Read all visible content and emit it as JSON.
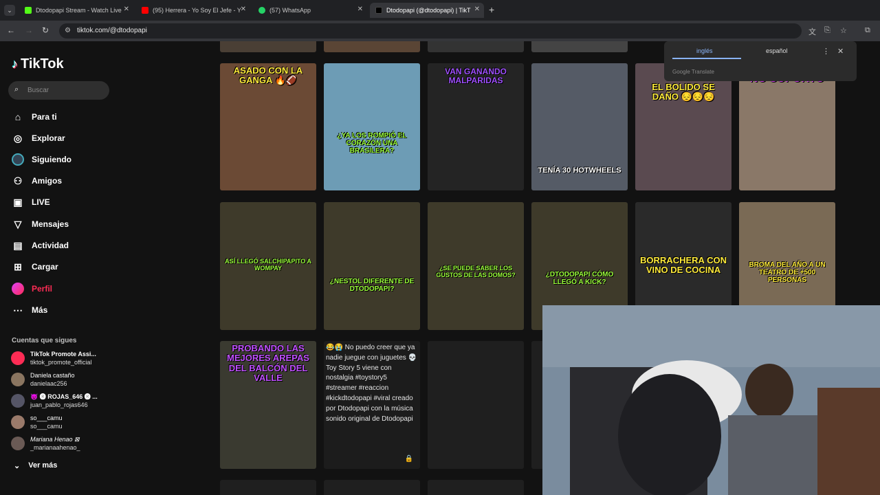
{
  "tabs": [
    {
      "title": "Dtodopapi Stream - Watch Live",
      "color": "#53fc18"
    },
    {
      "title": "(95) Herrera - Yo Soy El Jefe - Y",
      "color": "#ff0000"
    },
    {
      "title": "(57) WhatsApp",
      "color": "#25d366"
    },
    {
      "title": "Dtodopapi (@dtodopapi) | TikT",
      "color": "#000000"
    }
  ],
  "address": {
    "url": "tiktok.com/@dtodopapi"
  },
  "brand": {
    "name": "TikTok"
  },
  "search": {
    "placeholder": "Buscar"
  },
  "nav": [
    {
      "label": "Para ti",
      "icon": "home-icon"
    },
    {
      "label": "Explorar",
      "icon": "compass-icon"
    },
    {
      "label": "Siguiendo",
      "icon": "following-icon"
    },
    {
      "label": "Amigos",
      "icon": "friends-icon"
    },
    {
      "label": "LIVE",
      "icon": "live-icon"
    },
    {
      "label": "Mensajes",
      "icon": "messages-icon"
    },
    {
      "label": "Actividad",
      "icon": "activity-icon"
    },
    {
      "label": "Cargar",
      "icon": "upload-icon"
    },
    {
      "label": "Perfil",
      "icon": "profile-avatar"
    },
    {
      "label": "Más",
      "icon": "more-icon"
    }
  ],
  "following": {
    "title": "Cuentas que sigues",
    "accounts": [
      {
        "name": "TikTok Promote Assi...",
        "handle": "tiktok_promote_official"
      },
      {
        "name": "Daniela castaño",
        "handle": "danielaac256"
      },
      {
        "name": "😈 🅡 ROJAS_646 🅡 ...",
        "handle": "juan_pablo_rojas646"
      },
      {
        "name": "so___camu",
        "handle": "so___camu"
      },
      {
        "name": "Mariana Henao ⊠",
        "handle": "_marianaahenao_"
      }
    ],
    "see_more": "Ver más"
  },
  "translate": {
    "lang_from": "inglés",
    "lang_to": "español",
    "provider": "Google Translate"
  },
  "videos": {
    "row1": [
      {
        "caption": "ASADO CON LA GANGA 🔥🏈",
        "bg": "#6b4a35",
        "cap_color": "#ffeb3b"
      },
      {
        "caption": "¿YA LOS ROMPIÓ EL CORAZÓN UNA BRASILERA?",
        "bg": "#6d9cb5",
        "cap_color": "#9cff3b"
      },
      {
        "caption": "VAN GANANDO MALPARIDAS",
        "bg": "#242424",
        "cap_color": "#a050ff"
      },
      {
        "caption": "TENÍA 30 HOTWHEELS",
        "bg": "#555b66",
        "cap_color": "#ffffff"
      },
      {
        "caption": "EL BOLIDO SE DAÑO 😔😔😔",
        "bg": "#5a4a50",
        "cap_color": "#ffeb3b"
      },
      {
        "caption": "NO SOPORTO",
        "bg": "#8a7868",
        "cap_color": "#e040fb"
      }
    ],
    "row2": [
      {
        "caption": "ASÍ LLEGÓ SALCHIPAPITO A WOMPAY",
        "bg": "#3e3a2a",
        "cap_color": "#9cff3b"
      },
      {
        "caption": "¿NESTOL DIFERENTE DE DTODOPAPI?",
        "bg": "#3e3a2a",
        "cap_color": "#9cff3b"
      },
      {
        "caption": "¿SE PUEDE SABER LOS GUSTOS DE LAS DOMOS?",
        "bg": "#3e3a2a",
        "cap_color": "#9cff3b"
      },
      {
        "caption": "¿DTODOPAPI CÓMO LLEGÓ A KICK?",
        "bg": "#3e3a2a",
        "cap_color": "#9cff3b"
      },
      {
        "caption": "BORRACHERA CON VINO DE COCINA",
        "bg": "#2a2a2a",
        "cap_color": "#ffeb3b"
      },
      {
        "caption": "BROMA DEL AÑO A UN TEATRO DE +500 PERSONAS",
        "bg": "#7a6a55",
        "cap_color": "#ffeb3b"
      }
    ],
    "row3": [
      {
        "caption": "PROBANDO LAS MEJORES AREPAS DEL BALCÓN DEL VALLE",
        "bg": "#3a3a30",
        "cap_color": "#c050ff"
      }
    ],
    "description": "😂😭 No puedo creer que ya nadie juegue con juguetes 💀 Toy Story 5 viene con nostalgia #toystory5 #streamer #reaccion #kickdtodopapi #viral creado por Dtodopapi con la música sonido original de Dtodopapi"
  }
}
